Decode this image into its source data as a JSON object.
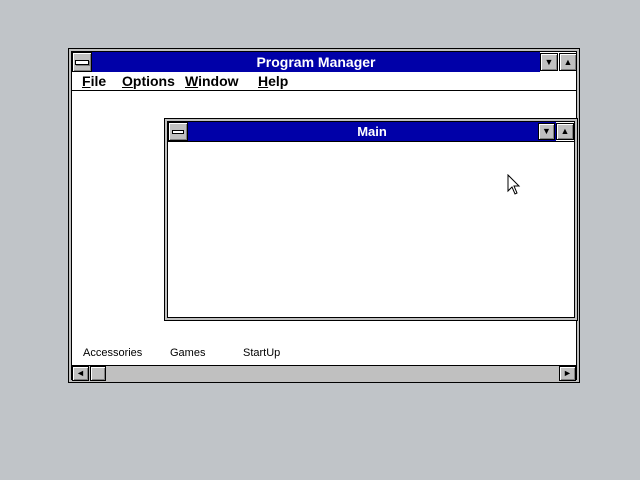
{
  "program_manager": {
    "title": "Program Manager",
    "menu": {
      "file": {
        "accel": "F",
        "rest": "ile"
      },
      "options": {
        "accel": "O",
        "rest": "ptions"
      },
      "window": {
        "accel": "W",
        "rest": "indow"
      },
      "help": {
        "accel": "H",
        "rest": "elp"
      }
    },
    "group_icons": [
      "Accessories",
      "Games",
      "StartUp"
    ]
  },
  "main_window": {
    "title": "Main"
  },
  "glyphs": {
    "minimize": "▼",
    "maximize": "▲",
    "scroll_left": "◄",
    "scroll_right": "►"
  },
  "colors": {
    "desktop": "#c0c4c8",
    "active_title": "#0000a8",
    "window_bg": "#ffffff"
  },
  "icons": [
    "system-menu-icon",
    "minimize-icon",
    "maximize-icon",
    "scroll-left-icon",
    "scroll-right-icon",
    "mouse-cursor-icon"
  ]
}
